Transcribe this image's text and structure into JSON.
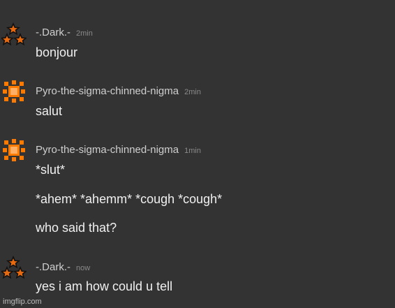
{
  "messages": [
    {
      "username": "-.Dark.-",
      "time": "2min",
      "lines": [
        "bonjour"
      ]
    },
    {
      "username": "Pyro-the-sigma-chinned-nigma",
      "time": "2min",
      "lines": [
        "salut"
      ]
    },
    {
      "username": "Pyro-the-sigma-chinned-nigma",
      "time": "1min",
      "lines": [
        "*slut*",
        "*ahem* *ahemm* *cough *cough*",
        "who said that?"
      ]
    },
    {
      "username": "-.Dark.-",
      "time": "now",
      "lines": [
        "yes i am how could u tell"
      ]
    }
  ],
  "watermark": "imgflip.com",
  "icons": {
    "dark_avatar": "stars-triangle-icon",
    "pyro_avatar": "orange-pixel-sun-icon"
  },
  "colors": {
    "background": "#333333",
    "username": "#cfcfcf",
    "timestamp": "#8a8a8a",
    "text": "#f0f0f0",
    "pyro_orange": "#ff7a00",
    "star_orange": "#e86a10"
  }
}
